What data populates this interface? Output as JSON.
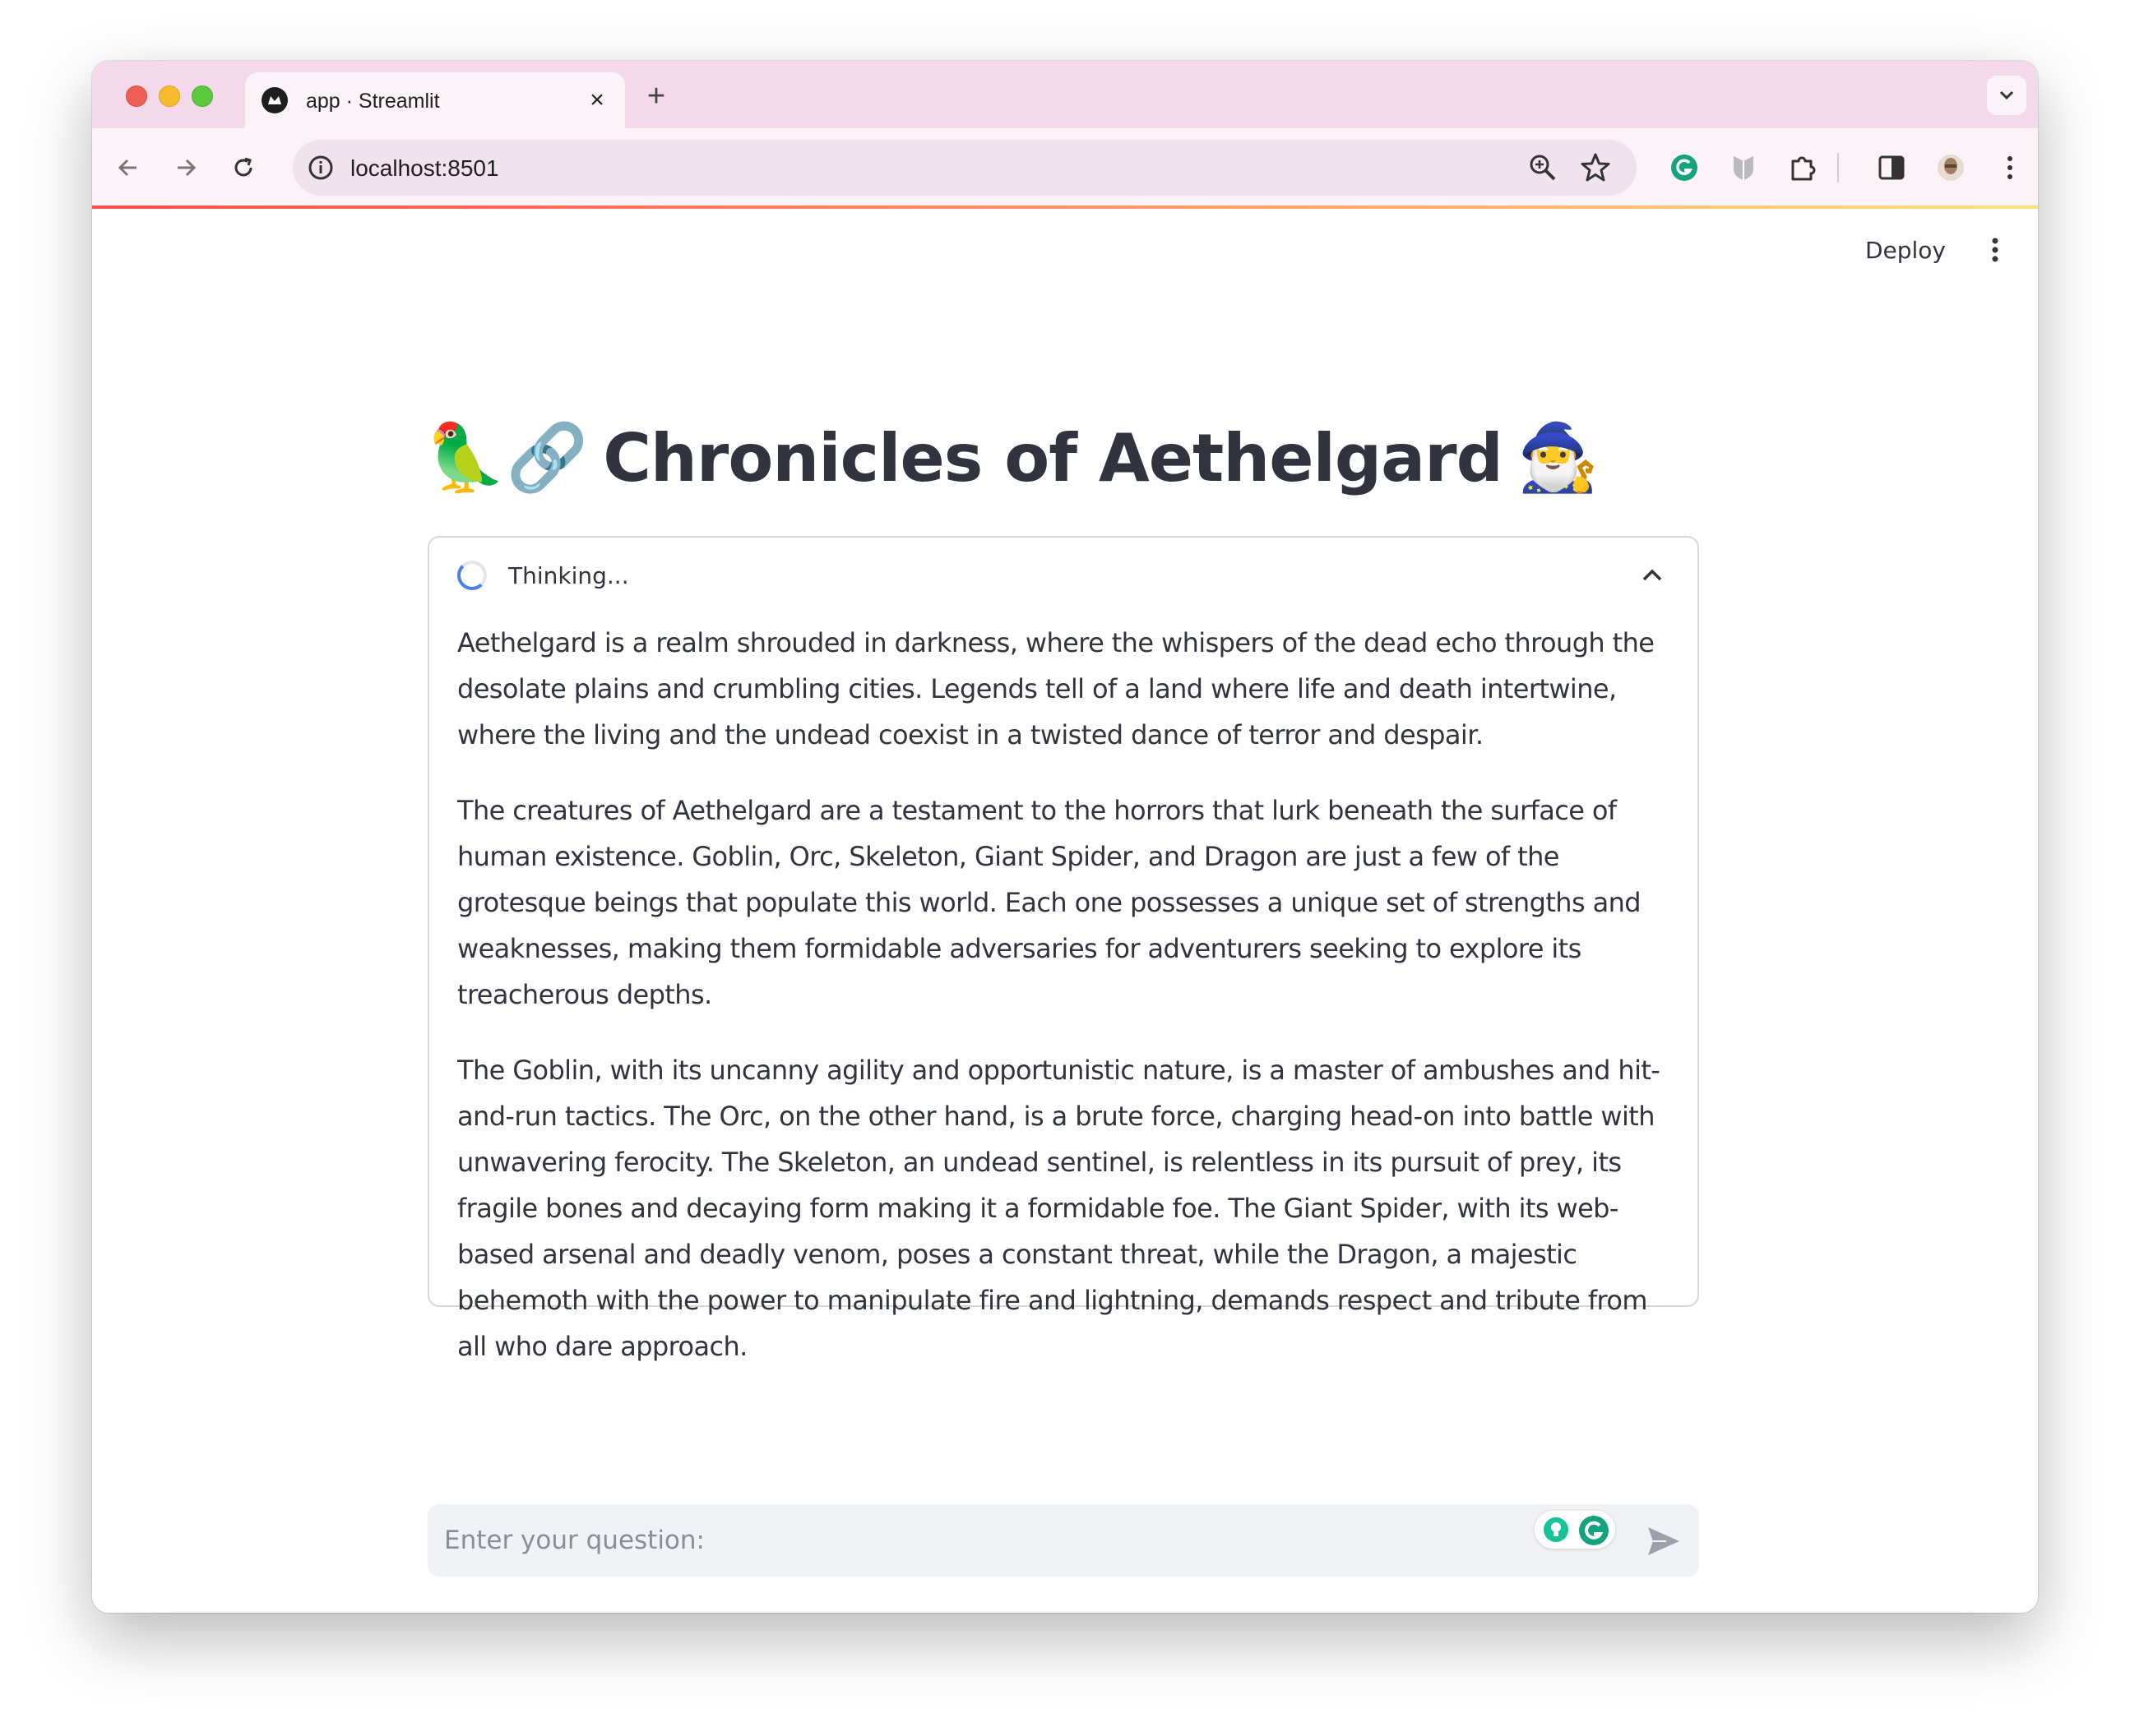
{
  "browser": {
    "tab_title": "app · Streamlit",
    "tab_close_icon": "×",
    "new_tab_icon": "+",
    "url": "localhost:8501",
    "icons": [
      "back-arrow-icon",
      "forward-arrow-icon",
      "reload-icon",
      "site-info-icon",
      "zoom-icon",
      "bookmark-star-icon",
      "grammarly-extension-icon",
      "shield-extension-icon",
      "extensions-puzzle-icon",
      "side-panel-icon",
      "profile-avatar-icon",
      "browser-menu-icon",
      "tab-search-chevron-icon"
    ]
  },
  "app": {
    "deploy_label": "Deploy",
    "title_emoji_left": "🦜🔗",
    "title": "Chronicles of Aethelgard",
    "title_emoji_right": "🧙‍♂️",
    "status": {
      "label": "Thinking..."
    },
    "paragraphs": [
      "Aethelgard is a realm shrouded in darkness, where the whispers of the dead echo through the desolate plains and crumbling cities. Legends tell of a land where life and death intertwine, where the living and the undead coexist in a twisted dance of terror and despair.",
      "The creatures of Aethelgard are a testament to the horrors that lurk beneath the surface of human existence. Goblin, Orc, Skeleton, Giant Spider, and Dragon are just a few of the grotesque beings that populate this world. Each one possesses a unique set of strengths and weaknesses, making them formidable adversaries for adventurers seeking to explore its treacherous depths.",
      "The Goblin, with its uncanny agility and opportunistic nature, is a master of ambushes and hit-and-run tactics. The Orc, on the other hand, is a brute force, charging head-on into battle with unwavering ferocity. The Skeleton, an undead sentinel, is relentless in its pursuit of prey, its fragile bones and decaying form making it a formidable foe. The Giant Spider, with its web-based arsenal and deadly venom, poses a constant threat, while the Dragon, a majestic behemoth with the power to manipulate fire and lightning, demands respect and tribute from all who dare approach."
    ],
    "chat_input": {
      "placeholder": "Enter your question:"
    }
  },
  "colors": {
    "tabstrip_bg": "#f3d9e9",
    "toolbar_bg": "#fbf3f8",
    "text": "#31333f",
    "spinner_accent": "#4a80e8",
    "chat_input_bg": "#f0f2f6",
    "grammarly_green": "#15c39a"
  }
}
